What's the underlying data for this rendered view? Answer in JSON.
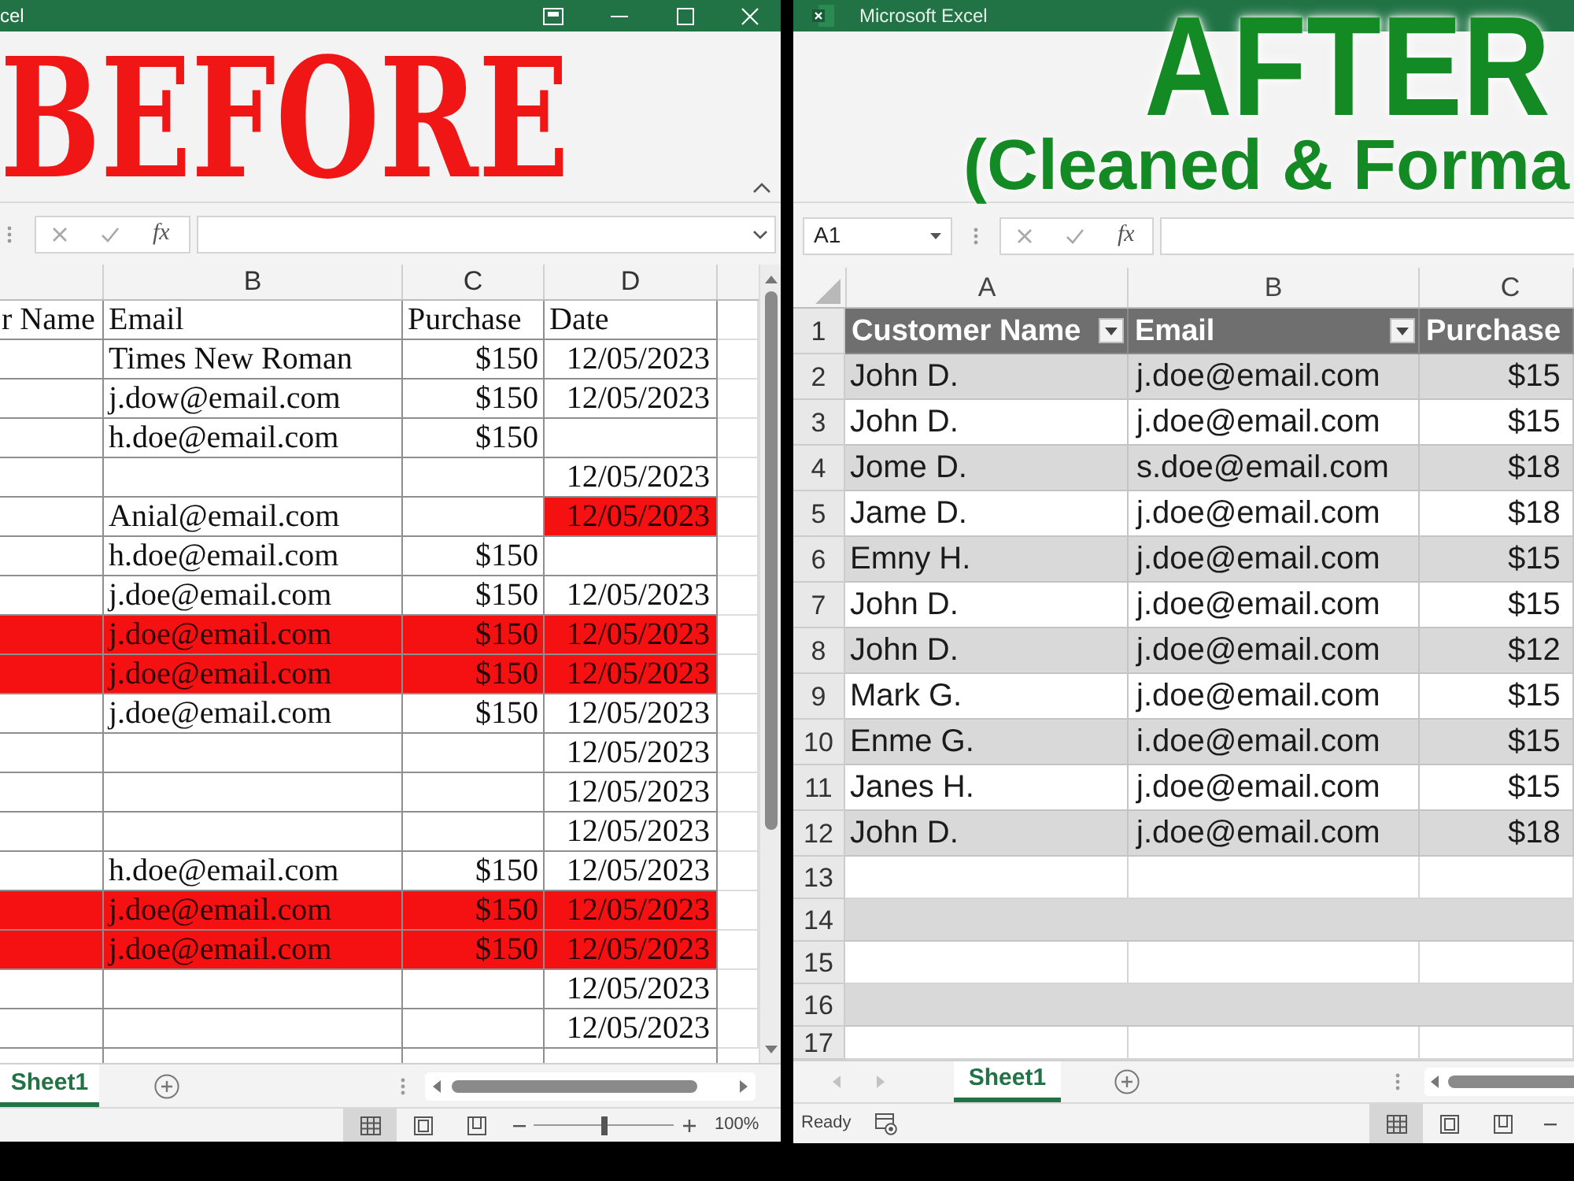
{
  "before": {
    "title": "cel",
    "banner": "BEFORE",
    "formula_bar": {
      "function_label": "fx"
    },
    "column_letters": [
      "B",
      "C",
      "D"
    ],
    "columns": [
      {
        "label": "r Name"
      },
      {
        "label": "Email"
      },
      {
        "label": "Purchase"
      },
      {
        "label": "Date"
      }
    ],
    "rows": [
      {
        "email": "Times New Roman",
        "purchase": "$150",
        "date": "12/05/2023",
        "highlighted": false,
        "date_highlighted": false
      },
      {
        "email": "j.dow@email.com",
        "purchase": "$150",
        "date": "12/05/2023",
        "highlighted": false,
        "date_highlighted": false
      },
      {
        "email": "h.doe@email.com",
        "purchase": "$150",
        "highlighted": false,
        "date_highlighted": false
      },
      {
        "date": "12/05/2023",
        "highlighted": false,
        "date_highlighted": false
      },
      {
        "email": "Anial@email.com",
        "date": "12/05/2023",
        "highlighted": false,
        "date_highlighted": true
      },
      {
        "email": "h.doe@email.com",
        "purchase": "$150",
        "highlighted": false,
        "date_highlighted": false
      },
      {
        "email": "j.doe@email.com",
        "purchase": "$150",
        "date": "12/05/2023",
        "highlighted": false,
        "date_highlighted": false
      },
      {
        "email": "j.doe@email.com",
        "purchase": "$150",
        "date": "12/05/2023",
        "highlighted": true,
        "date_highlighted": true
      },
      {
        "email": "j.doe@email.com",
        "purchase": "$150",
        "date": "12/05/2023",
        "highlighted": true,
        "date_highlighted": true
      },
      {
        "email": "j.doe@email.com",
        "purchase": "$150",
        "date": "12/05/2023",
        "highlighted": false,
        "date_highlighted": false
      },
      {
        "date": "12/05/2023",
        "highlighted": false,
        "date_highlighted": false
      },
      {
        "date": "12/05/2023",
        "highlighted": false,
        "date_highlighted": false
      },
      {
        "date": "12/05/2023",
        "highlighted": false,
        "date_highlighted": false
      },
      {
        "email": "h.doe@email.com",
        "purchase": "$150",
        "date": "12/05/2023",
        "highlighted": false,
        "date_highlighted": false
      },
      {
        "email": "j.doe@email.com",
        "purchase": "$150",
        "date": "12/05/2023",
        "highlighted": true,
        "date_highlighted": true
      },
      {
        "email": "j.doe@email.com",
        "purchase": "$150",
        "date": "12/05/2023",
        "highlighted": true,
        "date_highlighted": true
      },
      {
        "date": "12/05/2023",
        "highlighted": false,
        "date_highlighted": false
      },
      {
        "date": "12/05/2023",
        "highlighted": false,
        "date_highlighted": false
      }
    ],
    "sheet_tabs": [
      {
        "label": "Sheet1",
        "selected": true
      }
    ],
    "views": [
      {
        "kind": "normal",
        "selected": true
      },
      {
        "kind": "page_layout",
        "selected": false
      },
      {
        "kind": "page_break",
        "selected": false
      }
    ],
    "zoom": {
      "level": 0.5,
      "reading": "100%"
    }
  },
  "after": {
    "title": "Microsoft Excel",
    "banner_title": "AFTER",
    "banner_subtitle": "(Cleaned & Forma",
    "name_box": "A1",
    "formula_bar": {
      "function_label": "fx"
    },
    "column_letters": [
      "A",
      "B",
      "C"
    ],
    "header_row": {
      "number": "1",
      "columns": [
        {
          "label": "Customer Name",
          "filter": true
        },
        {
          "label": "Email",
          "filter": true
        },
        {
          "label": "Purchase",
          "filter": false
        }
      ]
    },
    "rows": [
      {
        "number": "2",
        "name": "John D.",
        "email": "j.doe@email.com",
        "purchase": "$15"
      },
      {
        "number": "3",
        "name": "John D.",
        "email": "j.doe@email.com",
        "purchase": "$15"
      },
      {
        "number": "4",
        "name": "Jome D.",
        "email": "s.doe@email.com",
        "purchase": "$18"
      },
      {
        "number": "5",
        "name": "Jame D.",
        "email": "j.doe@email.com",
        "purchase": "$18"
      },
      {
        "number": "6",
        "name": "Emny H.",
        "email": "j.doe@email.com",
        "purchase": "$15"
      },
      {
        "number": "7",
        "name": "John D.",
        "email": "j.doe@email.com",
        "purchase": "$15"
      },
      {
        "number": "8",
        "name": "John D.",
        "email": "j.doe@email.com",
        "purchase": "$12"
      },
      {
        "number": "9",
        "name": "Mark G.",
        "email": "j.doe@email.com",
        "purchase": "$15"
      },
      {
        "number": "10",
        "name": "Enme G.",
        "email": "i.doe@email.com",
        "purchase": "$15"
      },
      {
        "number": "11",
        "name": "Janes H.",
        "email": "j.doe@email.com",
        "purchase": "$15"
      },
      {
        "number": "12",
        "name": "John D.",
        "email": "j.doe@email.com",
        "purchase": "$18"
      }
    ],
    "empty_rows": [
      "13",
      "14",
      "15",
      "16",
      "17"
    ],
    "sheet_tabs": [
      {
        "label": "Sheet1",
        "selected": true
      }
    ],
    "status": "Ready",
    "views": [
      {
        "kind": "normal",
        "selected": true
      },
      {
        "kind": "page_layout",
        "selected": false
      },
      {
        "kind": "page_break",
        "selected": false
      }
    ]
  }
}
